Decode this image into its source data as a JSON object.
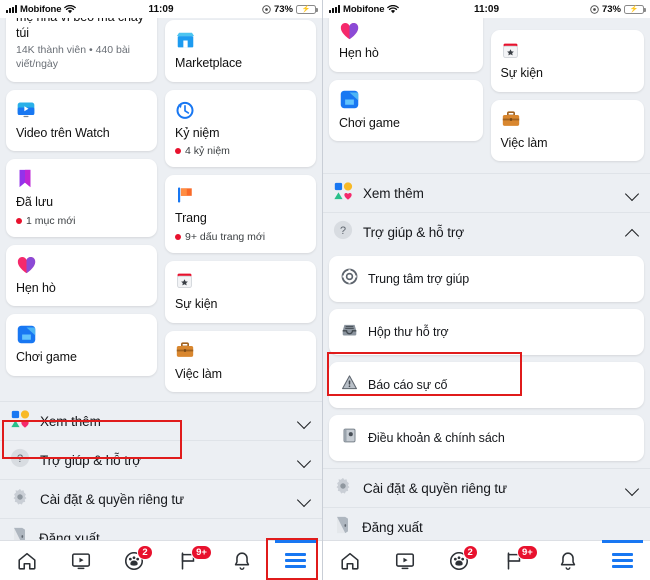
{
  "status_bar": {
    "carrier": "Mobifone",
    "time": "11:09",
    "battery_percent": "73%",
    "battery_level": 73,
    "wifi_icon": "wifi-icon",
    "signal_icon": "cellular-signal-icon",
    "lock_icon": "rotation-lock-icon",
    "battery_icon": "battery-charging-icon"
  },
  "left_screen": {
    "cards_left_column": [
      {
        "icon": "group-icon",
        "title": "mẹ nhà vì bèo mà cháy túi",
        "subtitle": "14K thành viên • 440 bài viết/ngày",
        "has_icon": false
      },
      {
        "icon": "watch-video-icon",
        "title": "Video trên Watch",
        "subtitle": ""
      },
      {
        "icon": "bookmark-icon",
        "title": "Đã lưu",
        "badge": "1 mục mới"
      },
      {
        "icon": "dating-heart-icon",
        "title": "Hẹn hò",
        "subtitle": ""
      },
      {
        "icon": "gaming-icon",
        "title": "Chơi game",
        "subtitle": ""
      }
    ],
    "cards_right_column": [
      {
        "icon": "marketplace-icon",
        "title": "Marketplace",
        "subtitle": ""
      },
      {
        "icon": "memories-clock-icon",
        "title": "Kỷ niệm",
        "badge": "4 kỷ niệm"
      },
      {
        "icon": "pages-flag-icon",
        "title": "Trang",
        "badge": "9+ dấu trang mới"
      },
      {
        "icon": "events-calendar-icon",
        "title": "Sự kiện",
        "subtitle": ""
      },
      {
        "icon": "jobs-briefcase-icon",
        "title": "Việc làm",
        "subtitle": ""
      }
    ],
    "sections": [
      {
        "icon": "see-more-shapes-icon",
        "label": "Xem thêm",
        "expanded": false
      },
      {
        "icon": "help-question-icon",
        "label": "Trợ giúp & hỗ trợ",
        "expanded": false,
        "highlighted": true
      },
      {
        "icon": "settings-gear-icon",
        "label": "Cài đặt & quyền riêng tư",
        "expanded": false
      },
      {
        "icon": "logout-door-icon",
        "label": "Đăng xuất",
        "expanded": null
      }
    ]
  },
  "right_screen": {
    "cards_left_column": [
      {
        "icon": "dating-heart-icon",
        "title": "Hẹn hò"
      },
      {
        "icon": "gaming-icon",
        "title": "Chơi game"
      }
    ],
    "cards_right_column": [
      {
        "icon": "events-calendar-icon",
        "title": "Sự kiện"
      },
      {
        "icon": "jobs-briefcase-icon",
        "title": "Việc làm"
      }
    ],
    "see_more": {
      "icon": "see-more-shapes-icon",
      "label": "Xem thêm",
      "expanded": false
    },
    "help_section": {
      "icon": "help-question-icon",
      "label": "Trợ giúp & hỗ trợ",
      "expanded": true,
      "items": [
        {
          "icon": "lifebuoy-icon",
          "label": "Trung tâm trợ giúp",
          "highlighted": false
        },
        {
          "icon": "support-inbox-icon",
          "label": "Hộp thư hỗ trợ",
          "highlighted": false
        },
        {
          "icon": "report-warning-icon",
          "label": "Báo cáo sự cố",
          "highlighted": true
        },
        {
          "icon": "terms-book-icon",
          "label": "Điều khoản & chính sách",
          "highlighted": false
        }
      ]
    },
    "settings_section": {
      "icon": "settings-gear-icon",
      "label": "Cài đặt & quyền riêng tư",
      "expanded": false
    },
    "logout": {
      "icon": "logout-door-icon",
      "label": "Đăng xuất"
    }
  },
  "bottom_nav": {
    "items": [
      {
        "icon": "home-icon",
        "label": "",
        "badge": "",
        "active": false
      },
      {
        "icon": "watch-video-icon",
        "label": "",
        "badge": "",
        "active": false
      },
      {
        "icon": "groups-icon",
        "label": "",
        "badge": "2",
        "active": false
      },
      {
        "icon": "pages-flag-nav-icon",
        "label": "",
        "badge": "9+",
        "active": false
      },
      {
        "icon": "notifications-bell-icon",
        "label": "",
        "badge": "",
        "active": false
      },
      {
        "icon": "menu-hamburger-icon",
        "label": "",
        "badge": "",
        "active": true
      }
    ]
  },
  "annotations": {
    "highlight_color": "#e01b1b",
    "boxes": [
      {
        "target": "help-support-row-left",
        "screen": "left"
      },
      {
        "target": "menu-hamburger-nav-left",
        "screen": "left"
      },
      {
        "target": "report-problem-item-right",
        "screen": "right"
      }
    ]
  },
  "colors": {
    "accent_blue": "#1877f2",
    "badge_red": "#e8112d",
    "page_bg": "#eceff3",
    "card_bg": "#ffffff",
    "text_primary": "#16181c",
    "text_secondary": "#6a6f76"
  }
}
